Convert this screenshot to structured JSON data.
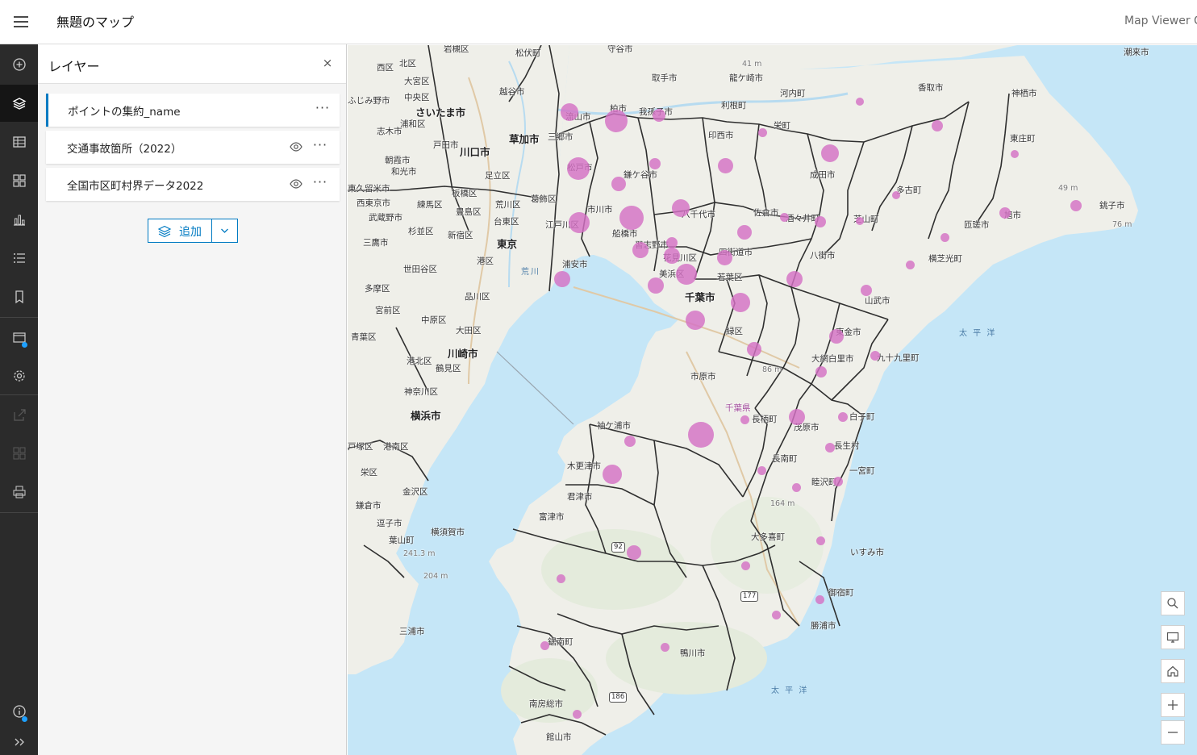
{
  "header": {
    "title": "無題のマップ",
    "app_name": "Map Viewer C"
  },
  "panel": {
    "title": "レイヤー",
    "close_label": "×",
    "layers": [
      {
        "name": "ポイントの集約_name",
        "selected": true,
        "visibility_icon": false
      },
      {
        "name": "交通事故箇所（2022）",
        "selected": false,
        "visibility_icon": true
      },
      {
        "name": "全国市区町村界データ2022",
        "selected": false,
        "visibility_icon": true
      }
    ],
    "more_label": "···",
    "add_button_label": "追加"
  },
  "rail": {
    "items": [
      "add-icon",
      "layers-icon",
      "table-icon",
      "basemap-icon",
      "charts-icon",
      "legend-icon",
      "bookmarks-icon",
      "map-properties-icon",
      "settings-icon",
      "share-icon",
      "create-app-icon",
      "print-icon",
      "info-icon",
      "expand-icon"
    ],
    "active": "layers-icon"
  },
  "map": {
    "labels": {
      "iwatsuki": "岩槻区",
      "matsubushi": "松伏町",
      "moriya": "守谷市",
      "choshi_area": "潮来市",
      "nishi": "西区",
      "kita": "北区",
      "omiya": "大宮区",
      "chuo_s": "中央区",
      "urawa": "浦和区",
      "saitama": "さいたま市",
      "koshigaya": "越谷市",
      "fujimino": "ふじみ野市",
      "shiki": "志木市",
      "toda": "戸田市",
      "kawaguchi": "川口市",
      "soka": "草加市",
      "misato": "三郷市",
      "asaka": "朝霞市",
      "wako": "和光市",
      "adachi": "足立区",
      "higashikurume": "東久留米市",
      "nishitokyo": "西東京市",
      "nerima": "練馬区",
      "itabashi": "板橋区",
      "arakawa": "荒川区",
      "katsushika": "葛飾区",
      "musashino": "武蔵野市",
      "toshima": "豊島区",
      "taito": "台東区",
      "suginami": "杉並区",
      "shinjuku": "新宿区",
      "tokyo": "東京",
      "mitaka": "三鷹市",
      "minato": "港区",
      "setagaya": "世田谷区",
      "shinagawa": "品川区",
      "komae": "多摩区",
      "miyamae": "宮前区",
      "nakahara": "中原区",
      "ota": "大田区",
      "aoba": "青葉区",
      "kohoku": "港北区",
      "kawasaki": "川崎市",
      "tsurumi": "鶴見区",
      "kanagawa": "神奈川区",
      "yokohama": "横浜市",
      "totsuka": "戸塚区",
      "konan": "港南区",
      "sakae": "栄区",
      "kanazawa": "金沢区",
      "kamakura": "鎌倉市",
      "zushi": "逗子市",
      "hayama": "葉山町",
      "yokosuka": "横須賀市",
      "miura": "三浦市",
      "toride": "取手市",
      "ryugasaki": "龍ケ崎市",
      "kawachi": "河内町",
      "katori": "香取市",
      "kamisu": "神栖市",
      "abiko": "我孫子市",
      "tone": "利根町",
      "nagareyama": "流山市",
      "kashiwa": "柏市",
      "inzai": "印西市",
      "sakae_t": "栄町",
      "tonosho": "東庄町",
      "matsudo": "松戸市",
      "kamagaya": "鎌ケ谷市",
      "narita": "成田市",
      "tako": "多古町",
      "ichikawa": "市川市",
      "funabashi": "船橋市",
      "yachiyo": "八千代市",
      "sakura": "佐倉市",
      "shisui": "酒々井町",
      "shibayama": "芝山町",
      "asahi": "旭市",
      "choshi": "銚子市",
      "sosa": "匝瑳市",
      "edogawa": "江戸川区",
      "urayasu": "浦安市",
      "narashino": "習志野市",
      "yotsukaido": "四街道市",
      "yachimata": "八街市",
      "yokoshiba": "横芝光町",
      "hanamigawa": "花見川区",
      "mihama": "美浜区",
      "wakaba": "若葉区",
      "chiba": "千葉市",
      "sammu": "山武市",
      "togane": "東金市",
      "oamishiro": "大網白里市",
      "kujukuri": "九十九里町",
      "midori": "緑区",
      "ichihara": "市原市",
      "chiba_pref": "千葉県",
      "sodegaura": "袖ケ浦市",
      "chonan": "長柄町",
      "mobara": "茂原市",
      "shirako": "白子町",
      "chosei": "長生村",
      "kisarazu": "木更津市",
      "chonan2": "長南町",
      "ichinomiya": "一宮町",
      "mutsuzawa": "睦沢町",
      "kimitsu": "君津市",
      "futtsu": "富津市",
      "otaki": "大多喜町",
      "isumi": "いすみ市",
      "onjuku": "御宿町",
      "katsuura": "勝浦市",
      "kyonan": "鋸南町",
      "kamogawa": "鴨川市",
      "minamiboso": "南房総市",
      "tateyama": "館山市",
      "pacific1": "太 平 洋",
      "pacific2": "太 平 洋",
      "arakawa_river": "荒川"
    },
    "elevations": [
      "41 m",
      "49 m",
      "76 m",
      "86 m",
      "164 m",
      "241.3 m",
      "204 m"
    ],
    "route_shields": [
      "92",
      "177",
      "186"
    ]
  },
  "controls": [
    "search-icon",
    "screen-icon",
    "home-icon",
    "zoom-in-icon",
    "zoom-out-icon"
  ]
}
